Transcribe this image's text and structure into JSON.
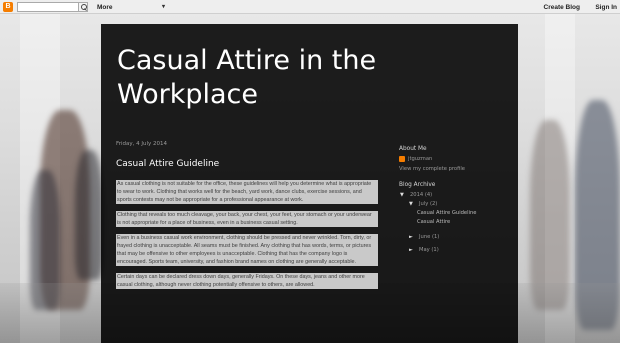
{
  "navbar": {
    "logo_letter": "B",
    "search_value": "",
    "more_label": "More",
    "more_arrow": "▾",
    "create_blog_label": "Create Blog",
    "sign_in_label": "Sign In"
  },
  "blog": {
    "title": "Casual Attire in the Workplace"
  },
  "post": {
    "date": "Friday, 4 July 2014",
    "title": "Casual Attire Guideline",
    "paragraphs": [
      "As casual clothing is not suitable for the office, these guidelines will help you determine what is appropriate to wear to work. Clothing that works well for the beach, yard work, dance clubs, exercise sessions, and sports contests may not be appropriate for a professional appearance at work.",
      "Clothing that reveals too much cleavage, your back, your chest, your feet, your stomach or your underwear is not appropriate for a place of business, even in a business casual setting.",
      "Even in a business casual work environment, clothing should be pressed and never wrinkled. Torn, dirty, or frayed clothing is unacceptable. All seams must be finished. Any clothing that has words, terms, or pictures that may be offensive to other employees is unacceptable. Clothing that has the company logo is encouraged. Sports team, university, and fashion brand names on clothing are generally acceptable.",
      "Certain days can be declared dress down days, generally Fridays. On these days, jeans and other more casual clothing, although never clothing potentially offensive to others, are allowed."
    ]
  },
  "sidebar": {
    "about_heading": "About Me",
    "profile_name": "jtguzman",
    "profile_link": "View my complete profile",
    "archive_heading": "Blog Archive",
    "archive": [
      {
        "arrow": "▼",
        "label": "2014 (4)"
      },
      {
        "arrow": "▼",
        "label": "July (2)"
      },
      {
        "arrow": "",
        "label": "Casual Attire Guideline"
      },
      {
        "arrow": "",
        "label": "Casual Attire"
      },
      {
        "arrow": "►",
        "label": "June (1)"
      },
      {
        "arrow": "►",
        "label": "May (1)"
      }
    ]
  },
  "colors": {
    "accent": "#f57d00",
    "panel": "#000000",
    "highlight": "#c9c9c9"
  }
}
